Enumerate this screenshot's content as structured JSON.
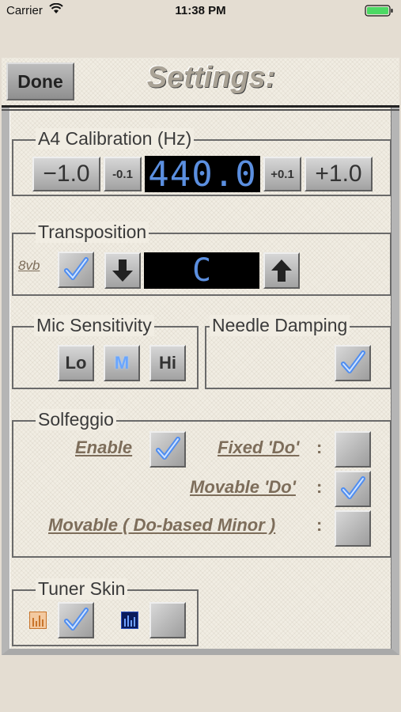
{
  "status_bar": {
    "carrier": "Carrier",
    "time": "11:38 PM"
  },
  "header": {
    "done_label": "Done",
    "title": "Settings:"
  },
  "calibration": {
    "legend": "A4 Calibration (Hz)",
    "minus_one": "−1.0",
    "minus_tenth": "-0.1",
    "value": "440.0",
    "plus_tenth": "+0.1",
    "plus_one": "+1.0"
  },
  "transposition": {
    "legend": "Transposition",
    "octave_label": "8vb",
    "octave_checked": true,
    "key": "C"
  },
  "mic": {
    "legend": "Mic Sensitivity",
    "lo": "Lo",
    "mid": "M",
    "hi": "Hi",
    "selected": "M"
  },
  "needle": {
    "legend": "Needle Damping",
    "checked": true
  },
  "solfeggio": {
    "legend": "Solfeggio",
    "enable_label": "Enable",
    "enable_checked": true,
    "fixed_do_label": "Fixed 'Do'",
    "fixed_do_checked": false,
    "movable_do_label": "Movable 'Do'",
    "movable_do_checked": true,
    "movable_minor_label": "Movable ( Do-based Minor )",
    "movable_minor_checked": false,
    "colon": ":"
  },
  "tuner_skin": {
    "legend": "Tuner Skin",
    "skins": [
      {
        "icon": "orange-bars-icon",
        "checked": true
      },
      {
        "icon": "blue-bars-icon",
        "checked": false
      }
    ]
  },
  "colors": {
    "check_blue": "#4f8df0",
    "display_text": "#5b8fe0",
    "label_brown": "#7d6d5a"
  }
}
